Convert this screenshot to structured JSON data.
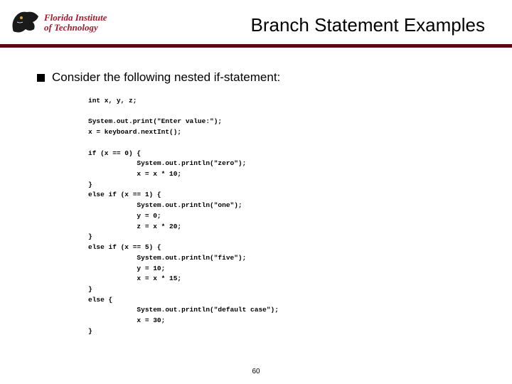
{
  "logo": {
    "line1": "Florida Institute",
    "line2": "of Technology"
  },
  "title": "Branch Statement Examples",
  "bullet": "Consider the following nested if-statement:",
  "code": "int x, y, z;\n\nSystem.out.print(\"Enter value:\");\nx = keyboard.nextInt();\n\nif (x == 0) {\n            System.out.println(\"zero\");\n            x = x * 10;\n}\nelse if (x == 1) {\n            System.out.println(\"one\");\n            y = 0;\n            z = x * 20;\n}\nelse if (x == 5) {\n            System.out.println(\"five\");\n            y = 10;\n            x = x * 15;\n}\nelse {\n            System.out.println(\"default case\");\n            x = 30;\n}",
  "page_number": "60"
}
